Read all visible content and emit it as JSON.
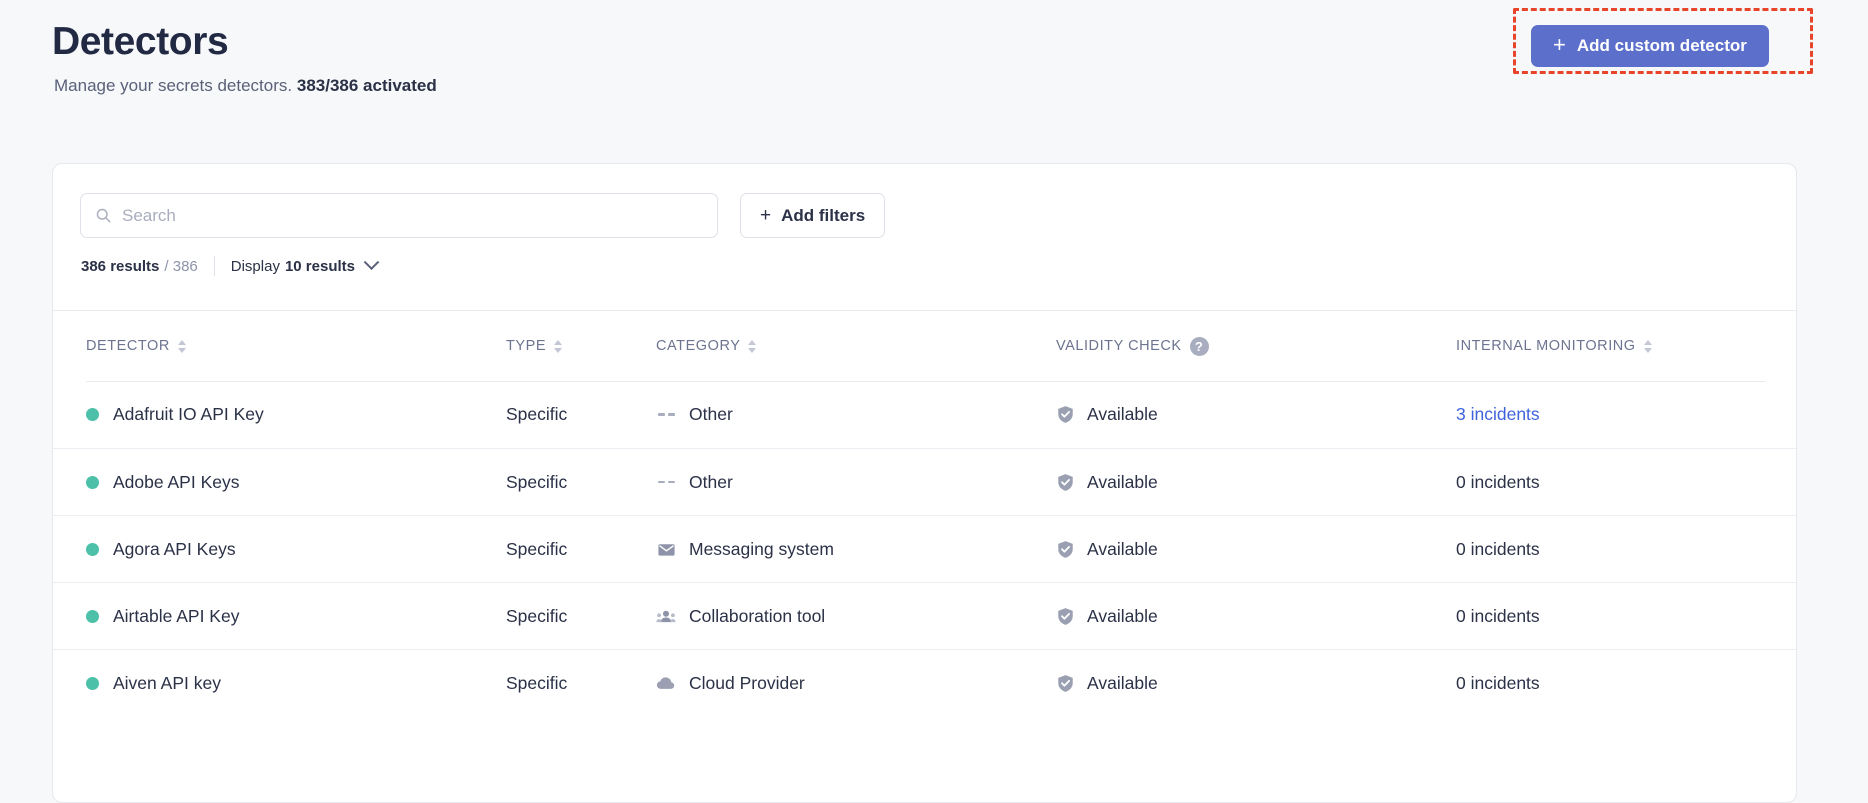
{
  "header": {
    "title": "Detectors",
    "subtitle_text": "Manage your secrets detectors.",
    "subtitle_strong": "383/386 activated",
    "add_button_label": "Add custom detector",
    "add_button_icon": "plus-icon",
    "accent_color": "#5c6fcb",
    "highlight_color": "#e8442a"
  },
  "toolbar": {
    "search_placeholder": "Search",
    "search_value": "",
    "search_icon": "search-icon",
    "add_filters_label": "Add filters",
    "add_filters_icon": "plus-icon",
    "results_count": "386 results",
    "results_total": "/ 386",
    "display_label": "Display",
    "display_value": "10 results",
    "display_chevron_icon": "chevron-down-icon"
  },
  "table": {
    "columns": [
      {
        "label": "DETECTOR",
        "sortable": true,
        "help": false
      },
      {
        "label": "TYPE",
        "sortable": true,
        "help": false
      },
      {
        "label": "CATEGORY",
        "sortable": true,
        "help": false
      },
      {
        "label": "VALIDITY CHECK",
        "sortable": false,
        "help": true,
        "help_glyph": "?"
      },
      {
        "label": "INTERNAL MONITORING",
        "sortable": true,
        "help": false
      }
    ],
    "rows": [
      {
        "status": "active",
        "status_color": "#4cc0a8",
        "detector": "Adafruit IO API Key",
        "type": "Specific",
        "category": "Other",
        "category_icon": "dashes-icon",
        "validity": "Available",
        "validity_icon": "shield-check-icon",
        "monitoring": "3 incidents",
        "monitoring_is_link": true
      },
      {
        "status": "active",
        "status_color": "#4cc0a8",
        "detector": "Adobe API Keys",
        "type": "Specific",
        "category": "Other",
        "category_icon": "dashes-icon",
        "validity": "Available",
        "validity_icon": "shield-check-icon",
        "monitoring": "0 incidents",
        "monitoring_is_link": false
      },
      {
        "status": "active",
        "status_color": "#4cc0a8",
        "detector": "Agora API Keys",
        "type": "Specific",
        "category": "Messaging system",
        "category_icon": "envelope-icon",
        "validity": "Available",
        "validity_icon": "shield-check-icon",
        "monitoring": "0 incidents",
        "monitoring_is_link": false
      },
      {
        "status": "active",
        "status_color": "#4cc0a8",
        "detector": "Airtable API Key",
        "type": "Specific",
        "category": "Collaboration tool",
        "category_icon": "people-icon",
        "validity": "Available",
        "validity_icon": "shield-check-icon",
        "monitoring": "0 incidents",
        "monitoring_is_link": false
      },
      {
        "status": "active",
        "status_color": "#4cc0a8",
        "detector": "Aiven API key",
        "type": "Specific",
        "category": "Cloud Provider",
        "category_icon": "cloud-icon",
        "validity": "Available",
        "validity_icon": "shield-check-icon",
        "monitoring": "0 incidents",
        "monitoring_is_link": false
      }
    ]
  }
}
